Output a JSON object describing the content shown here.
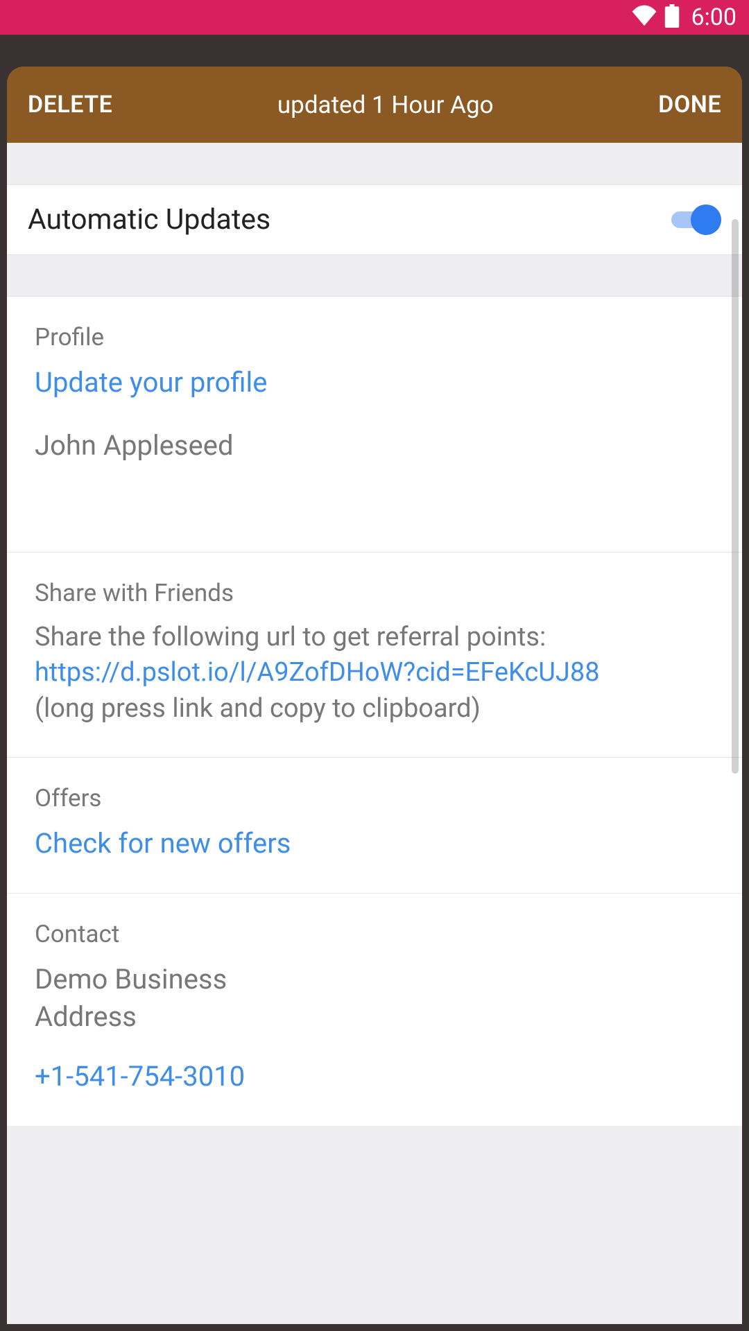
{
  "status": {
    "time": "6:00"
  },
  "header": {
    "delete_label": "DELETE",
    "title": "updated 1 Hour Ago",
    "done_label": "DONE"
  },
  "auto_updates": {
    "label": "Automatic Updates"
  },
  "profile": {
    "title": "Profile",
    "link": "Update your profile",
    "name": "John Appleseed"
  },
  "share": {
    "title": "Share with Friends",
    "intro": "Share the following url to get referral points:",
    "url": "https://d.pslot.io/l/A9ZofDHoW?cid=EFeKcUJ88",
    "hint": "(long press link and copy to clipboard)"
  },
  "offers": {
    "title": "Offers",
    "link": "Check for new offers"
  },
  "contact": {
    "title": "Contact",
    "line1": "Demo Business",
    "line2": "Address",
    "phone": "+1-541-754-3010"
  }
}
